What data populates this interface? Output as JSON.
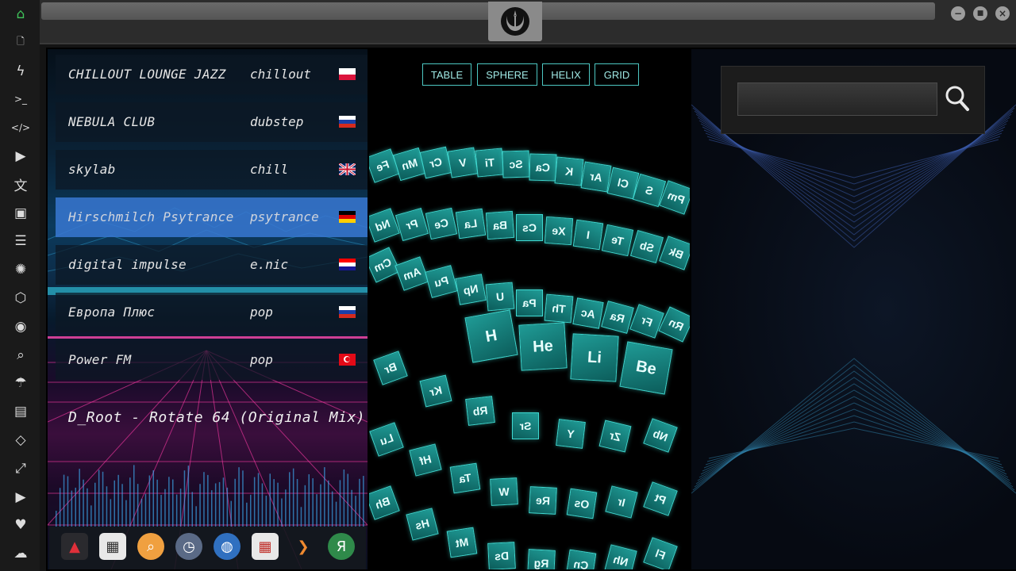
{
  "sidebar": {
    "items": [
      {
        "icon": "home-icon",
        "glyph": "⌂"
      },
      {
        "icon": "document-icon",
        "glyph": "🗋"
      },
      {
        "icon": "lightning-icon",
        "glyph": "ϟ"
      },
      {
        "icon": "terminal-icon",
        "glyph": ">_"
      },
      {
        "icon": "code-icon",
        "glyph": "</>"
      },
      {
        "icon": "play-icon",
        "glyph": "▶"
      },
      {
        "icon": "translate-icon",
        "glyph": "文"
      },
      {
        "icon": "image-icon",
        "glyph": "▣"
      },
      {
        "icon": "news-icon",
        "glyph": "☰"
      },
      {
        "icon": "rebel-icon",
        "glyph": "✺"
      },
      {
        "icon": "hexagon-icon",
        "glyph": "⬡"
      },
      {
        "icon": "globe-icon",
        "glyph": "◉"
      },
      {
        "icon": "search-icon",
        "glyph": "⌕"
      },
      {
        "icon": "umbrella-icon",
        "glyph": "☂"
      },
      {
        "icon": "contact-icon",
        "glyph": "▤"
      },
      {
        "icon": "diamond-code-icon",
        "glyph": "◇"
      },
      {
        "icon": "fullscreen-icon",
        "glyph": "⤢"
      },
      {
        "icon": "youtube-icon",
        "glyph": "▶"
      },
      {
        "icon": "heart-icon",
        "glyph": "♥"
      },
      {
        "icon": "cloud-icon",
        "glyph": "☁"
      }
    ]
  },
  "window": {
    "minimize_glyph": "−",
    "maximize_glyph": "■",
    "close_glyph": "×"
  },
  "radio": {
    "stations": [
      {
        "name": "CHILLOUT LOUNGE JAZZ",
        "genre": "chillout",
        "flag": "pl",
        "active": false
      },
      {
        "name": "NEBULA CLUB",
        "genre": "dubstep",
        "flag": "ru",
        "active": false
      },
      {
        "name": "skylab",
        "genre": "chill",
        "flag": "gb",
        "active": false
      },
      {
        "name": "Hirschmilch Psytrance",
        "genre": "psytrance",
        "flag": "de",
        "active": true
      },
      {
        "name": "digital impulse",
        "genre": "e.nic",
        "flag": "hr",
        "active": false
      },
      {
        "name": "Европа Плюс",
        "genre": "pop",
        "flag": "ru",
        "active": false
      },
      {
        "name": "Power FM",
        "genre": "pop",
        "flag": "tr",
        "active": false
      }
    ],
    "now_playing": "D_Root - Rotate 64 (Original Mix)",
    "dock_apps": [
      {
        "icon": "vector-app-icon",
        "glyph": "▲",
        "bg": "#2a2a2e",
        "fg": "#e0303a"
      },
      {
        "icon": "news-app-icon",
        "glyph": "▦",
        "bg": "#e8e8e8",
        "fg": "#333"
      },
      {
        "icon": "search-app-icon",
        "glyph": "⌕",
        "bg": "#f0a040",
        "fg": "#fff"
      },
      {
        "icon": "clock-app-icon",
        "glyph": "◷",
        "bg": "#5a6a86",
        "fg": "#fff"
      },
      {
        "icon": "globe-app-icon",
        "glyph": "◍",
        "bg": "#3070c0",
        "fg": "#fff"
      },
      {
        "icon": "calendar-app-icon",
        "glyph": "▦",
        "bg": "#e8e8e8",
        "fg": "#c0302a"
      },
      {
        "icon": "arrow-app-icon",
        "glyph": "❯",
        "bg": "transparent",
        "fg": "#f08a30"
      },
      {
        "icon": "yandex-app-icon",
        "glyph": "Я",
        "bg": "#2f8a4a",
        "fg": "#fff"
      }
    ]
  },
  "periodic": {
    "modes": [
      "TABLE",
      "SPHERE",
      "HELIX",
      "GRID"
    ],
    "tiles_back": [
      "Fe",
      "Mn",
      "Cr",
      "V",
      "Ti",
      "Sc",
      "Ca",
      "K",
      "Ar",
      "Cl",
      "S",
      "Pm",
      "Nd",
      "Pr",
      "Ce",
      "La",
      "Ba",
      "Cs",
      "Xe",
      "I",
      "Te",
      "Sb",
      "Bk",
      "Cm",
      "Am",
      "Pu",
      "Np",
      "U",
      "Pa",
      "Th",
      "Ac",
      "Ra",
      "Fr",
      "Rn"
    ],
    "tiles_front": [
      "H",
      "He",
      "Li",
      "Be"
    ],
    "tiles_lower": [
      "Br",
      "Kr",
      "Rb",
      "Sr",
      "Y",
      "Zr",
      "Nb",
      "Lu",
      "Hf",
      "Ta",
      "W",
      "Re",
      "Os",
      "Ir",
      "Pt",
      "Bh",
      "Hs",
      "Mt",
      "Ds",
      "Rg",
      "Cn",
      "Nh",
      "Fl"
    ]
  },
  "search": {
    "value": "",
    "placeholder": ""
  }
}
